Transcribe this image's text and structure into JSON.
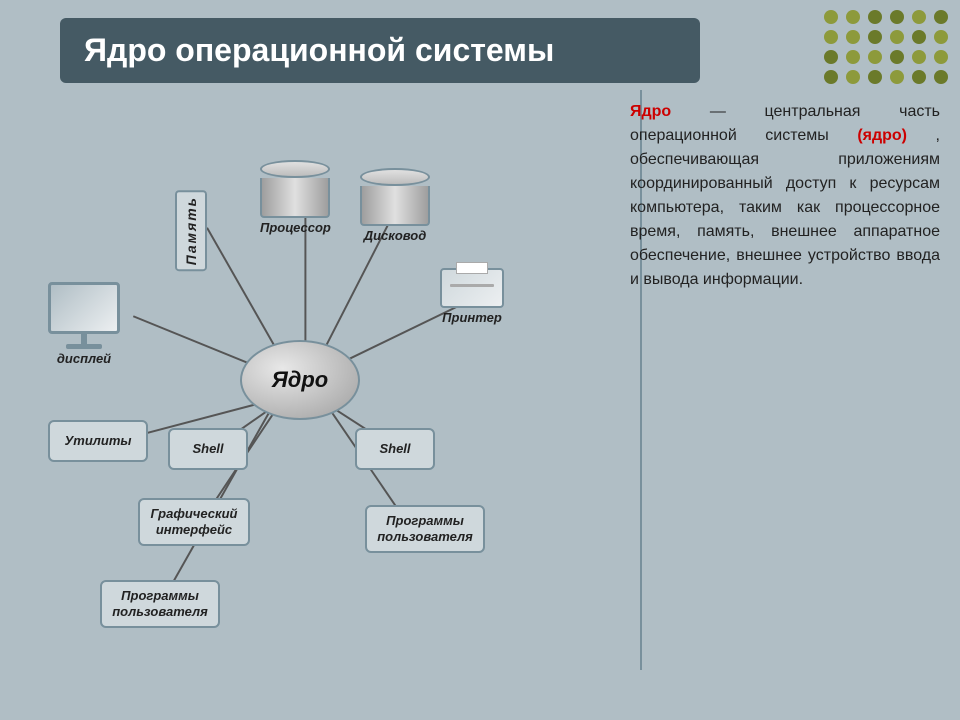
{
  "title": "Ядро операционной системы",
  "description_parts": [
    {
      "text": "Ядро",
      "bold": true,
      "color": "red"
    },
    {
      "text": " — центральная часть операционной системы "
    },
    {
      "text": "(ядро)",
      "bold": true,
      "color": "red"
    },
    {
      "text": ", обеспечивающая приложениям координированный доступ к ресурсам компьютера, таким как процессорное время, память, внешнее аппаратное обеспечение, внешнее устройство ввода и вывода информации."
    }
  ],
  "components": {
    "kernel": "Ядро",
    "display": "дисплей",
    "memory": "П а м я т ь",
    "processor": "Процессор",
    "disk": "Дисковод",
    "printer": "Принтер",
    "utilities": "Утилиты",
    "shell1": "Shell",
    "shell2": "Shell",
    "graphical": "Графический интерфейс",
    "user_programs1": "Программы пользователя",
    "user_programs2": "Программы пользователя"
  },
  "dots": {
    "colors": [
      "olive",
      "olive",
      "dark-olive",
      "dark-olive",
      "olive",
      "dark-olive",
      "olive",
      "olive",
      "dark-olive",
      "olive",
      "dark-olive",
      "olive",
      "dark-olive",
      "olive",
      "olive",
      "dark-olive",
      "olive",
      "olive",
      "dark-olive",
      "olive",
      "dark-olive",
      "olive",
      "dark-olive",
      "dark-olive",
      "dark-olive",
      "olive",
      "dark-olive",
      "olive",
      "dark-olive",
      "dark-olive"
    ]
  }
}
